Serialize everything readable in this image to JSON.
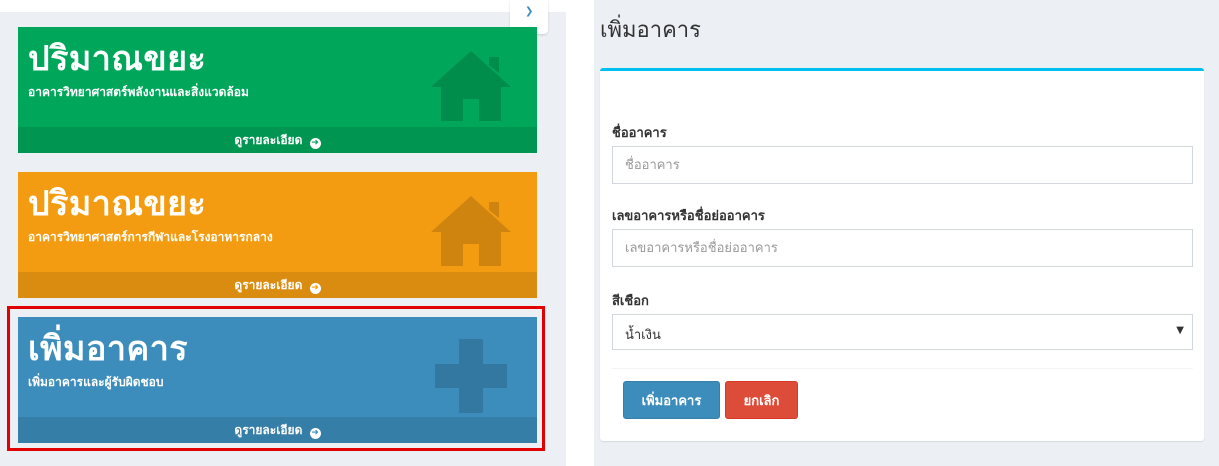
{
  "tiles": [
    {
      "title": "ปริมาณขยะ",
      "subtitle": "อาคารวิทยาศาสตร์พลังงานและสิ่งแวดล้อม",
      "footer": "ดูรายละเอียด",
      "icon": "home-icon",
      "color": "#00a65a"
    },
    {
      "title": "ปริมาณขยะ",
      "subtitle": "อาคารวิทยาศาสตร์การกีฬาและโรงอาหารกลาง",
      "footer": "ดูรายละเอียด",
      "icon": "home-icon",
      "color": "#f39c12"
    },
    {
      "title": "เพิ่มอาคาร",
      "subtitle": "เพิ่มอาคารและผู้รับผิดชอบ",
      "footer": "ดูรายละเอียด",
      "icon": "plus-icon",
      "color": "#3c8dbc"
    }
  ],
  "form": {
    "page_title": "เพิ่มอาคาร",
    "building_name_label": "ชื่ออาคาร",
    "building_name_placeholder": "ชื่ออาคาร",
    "building_code_label": "เลขอาคารหรือชื่อย่ออาคาร",
    "building_code_placeholder": "เลขอาคารหรือชื่อย่ออาคาร",
    "color_label": "สีเชือก",
    "color_selected": "น้ำเงิน",
    "submit_label": "เพิ่มอาคาร",
    "cancel_label": "ยกเลิก"
  },
  "colors": {
    "box_top_border": "#00c0ef",
    "highlight": "#e00000",
    "primary": "#3c8dbc",
    "danger": "#dd4b39"
  }
}
